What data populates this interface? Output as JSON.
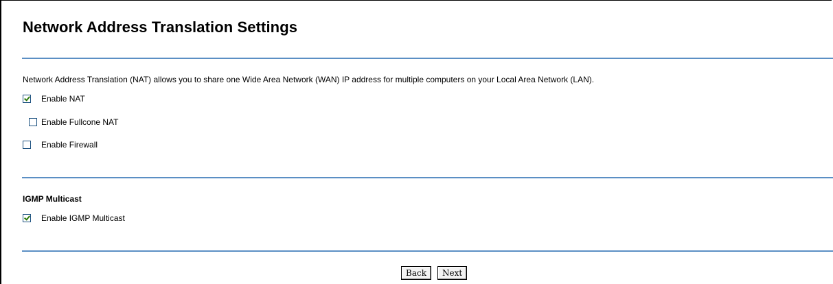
{
  "page": {
    "title": "Network Address Translation Settings",
    "description": "Network Address Translation (NAT) allows you to share one Wide Area Network (WAN) IP address for multiple computers on your Local Area Network (LAN)."
  },
  "nat": {
    "enable_nat": {
      "label": "Enable NAT",
      "checked": true
    },
    "enable_fullcone_nat": {
      "label": "Enable Fullcone NAT",
      "checked": false
    },
    "enable_firewall": {
      "label": "Enable Firewall",
      "checked": false
    }
  },
  "igmp": {
    "section_title": "IGMP Multicast",
    "enable_igmp_multicast": {
      "label": "Enable IGMP Multicast",
      "checked": true
    }
  },
  "buttons": {
    "back": "Back",
    "next": "Next"
  },
  "colors": {
    "rule": "#5b8fc4",
    "check": "#2b7a0b",
    "checkbox_border": "#1c5180"
  }
}
